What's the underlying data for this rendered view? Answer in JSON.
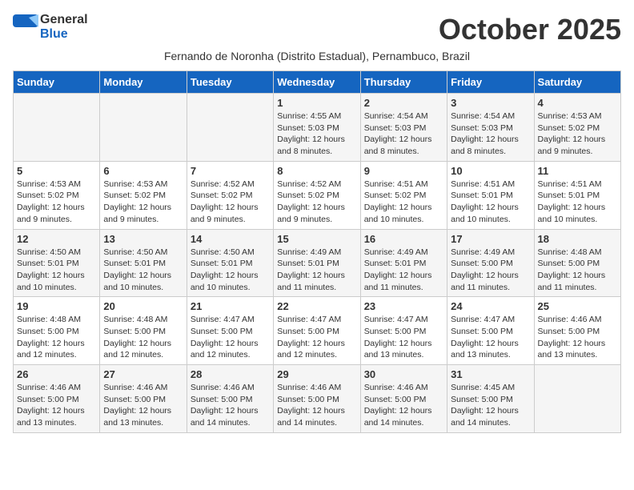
{
  "header": {
    "logo_general": "General",
    "logo_blue": "Blue",
    "month_title": "October 2025",
    "subtitle": "Fernando de Noronha (Distrito Estadual), Pernambuco, Brazil"
  },
  "weekdays": [
    "Sunday",
    "Monday",
    "Tuesday",
    "Wednesday",
    "Thursday",
    "Friday",
    "Saturday"
  ],
  "weeks": [
    [
      {
        "day": "",
        "info": ""
      },
      {
        "day": "",
        "info": ""
      },
      {
        "day": "",
        "info": ""
      },
      {
        "day": "1",
        "info": "Sunrise: 4:55 AM\nSunset: 5:03 PM\nDaylight: 12 hours\nand 8 minutes."
      },
      {
        "day": "2",
        "info": "Sunrise: 4:54 AM\nSunset: 5:03 PM\nDaylight: 12 hours\nand 8 minutes."
      },
      {
        "day": "3",
        "info": "Sunrise: 4:54 AM\nSunset: 5:03 PM\nDaylight: 12 hours\nand 8 minutes."
      },
      {
        "day": "4",
        "info": "Sunrise: 4:53 AM\nSunset: 5:02 PM\nDaylight: 12 hours\nand 9 minutes."
      }
    ],
    [
      {
        "day": "5",
        "info": "Sunrise: 4:53 AM\nSunset: 5:02 PM\nDaylight: 12 hours\nand 9 minutes."
      },
      {
        "day": "6",
        "info": "Sunrise: 4:53 AM\nSunset: 5:02 PM\nDaylight: 12 hours\nand 9 minutes."
      },
      {
        "day": "7",
        "info": "Sunrise: 4:52 AM\nSunset: 5:02 PM\nDaylight: 12 hours\nand 9 minutes."
      },
      {
        "day": "8",
        "info": "Sunrise: 4:52 AM\nSunset: 5:02 PM\nDaylight: 12 hours\nand 9 minutes."
      },
      {
        "day": "9",
        "info": "Sunrise: 4:51 AM\nSunset: 5:02 PM\nDaylight: 12 hours\nand 10 minutes."
      },
      {
        "day": "10",
        "info": "Sunrise: 4:51 AM\nSunset: 5:01 PM\nDaylight: 12 hours\nand 10 minutes."
      },
      {
        "day": "11",
        "info": "Sunrise: 4:51 AM\nSunset: 5:01 PM\nDaylight: 12 hours\nand 10 minutes."
      }
    ],
    [
      {
        "day": "12",
        "info": "Sunrise: 4:50 AM\nSunset: 5:01 PM\nDaylight: 12 hours\nand 10 minutes."
      },
      {
        "day": "13",
        "info": "Sunrise: 4:50 AM\nSunset: 5:01 PM\nDaylight: 12 hours\nand 10 minutes."
      },
      {
        "day": "14",
        "info": "Sunrise: 4:50 AM\nSunset: 5:01 PM\nDaylight: 12 hours\nand 10 minutes."
      },
      {
        "day": "15",
        "info": "Sunrise: 4:49 AM\nSunset: 5:01 PM\nDaylight: 12 hours\nand 11 minutes."
      },
      {
        "day": "16",
        "info": "Sunrise: 4:49 AM\nSunset: 5:01 PM\nDaylight: 12 hours\nand 11 minutes."
      },
      {
        "day": "17",
        "info": "Sunrise: 4:49 AM\nSunset: 5:00 PM\nDaylight: 12 hours\nand 11 minutes."
      },
      {
        "day": "18",
        "info": "Sunrise: 4:48 AM\nSunset: 5:00 PM\nDaylight: 12 hours\nand 11 minutes."
      }
    ],
    [
      {
        "day": "19",
        "info": "Sunrise: 4:48 AM\nSunset: 5:00 PM\nDaylight: 12 hours\nand 12 minutes."
      },
      {
        "day": "20",
        "info": "Sunrise: 4:48 AM\nSunset: 5:00 PM\nDaylight: 12 hours\nand 12 minutes."
      },
      {
        "day": "21",
        "info": "Sunrise: 4:47 AM\nSunset: 5:00 PM\nDaylight: 12 hours\nand 12 minutes."
      },
      {
        "day": "22",
        "info": "Sunrise: 4:47 AM\nSunset: 5:00 PM\nDaylight: 12 hours\nand 12 minutes."
      },
      {
        "day": "23",
        "info": "Sunrise: 4:47 AM\nSunset: 5:00 PM\nDaylight: 12 hours\nand 13 minutes."
      },
      {
        "day": "24",
        "info": "Sunrise: 4:47 AM\nSunset: 5:00 PM\nDaylight: 12 hours\nand 13 minutes."
      },
      {
        "day": "25",
        "info": "Sunrise: 4:46 AM\nSunset: 5:00 PM\nDaylight: 12 hours\nand 13 minutes."
      }
    ],
    [
      {
        "day": "26",
        "info": "Sunrise: 4:46 AM\nSunset: 5:00 PM\nDaylight: 12 hours\nand 13 minutes."
      },
      {
        "day": "27",
        "info": "Sunrise: 4:46 AM\nSunset: 5:00 PM\nDaylight: 12 hours\nand 13 minutes."
      },
      {
        "day": "28",
        "info": "Sunrise: 4:46 AM\nSunset: 5:00 PM\nDaylight: 12 hours\nand 14 minutes."
      },
      {
        "day": "29",
        "info": "Sunrise: 4:46 AM\nSunset: 5:00 PM\nDaylight: 12 hours\nand 14 minutes."
      },
      {
        "day": "30",
        "info": "Sunrise: 4:46 AM\nSunset: 5:00 PM\nDaylight: 12 hours\nand 14 minutes."
      },
      {
        "day": "31",
        "info": "Sunrise: 4:45 AM\nSunset: 5:00 PM\nDaylight: 12 hours\nand 14 minutes."
      },
      {
        "day": "",
        "info": ""
      }
    ]
  ]
}
